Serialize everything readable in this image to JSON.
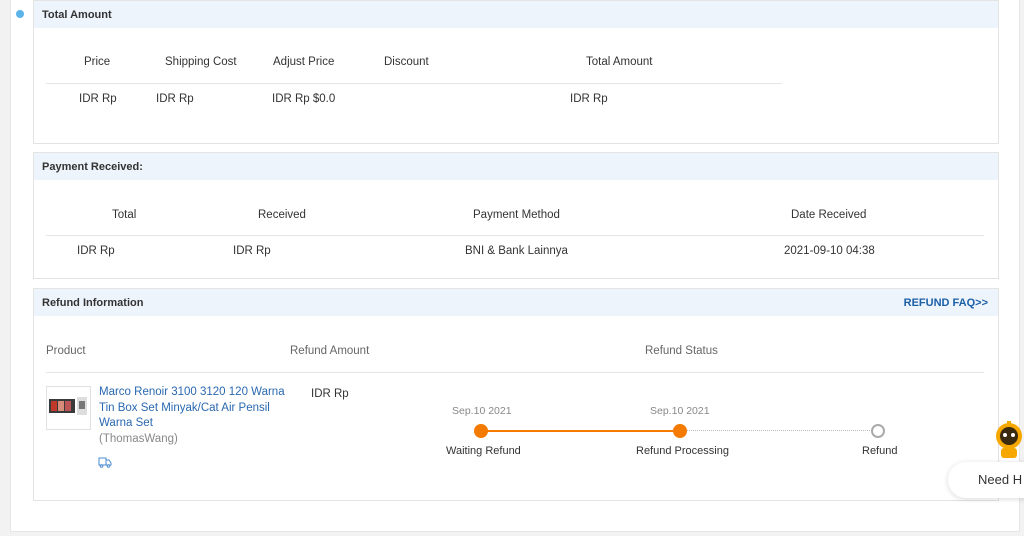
{
  "total_amount": {
    "title": "Total Amount",
    "headers": [
      "Price",
      "Shipping Cost",
      "Adjust Price",
      "Discount",
      "Total Amount"
    ],
    "row": {
      "price": "IDR Rp",
      "shipping": "IDR Rp",
      "adjust": "IDR Rp $0.0",
      "discount": "",
      "total": "IDR Rp"
    }
  },
  "payment": {
    "title": "Payment Received:",
    "headers": [
      "Total",
      "Received",
      "Payment Method",
      "Date Received"
    ],
    "row": {
      "total": "IDR Rp",
      "received": "IDR Rp",
      "method": "BNI & Bank Lainnya",
      "date": "2021-09-10 04:38"
    }
  },
  "refund": {
    "title": "Refund Information",
    "faq_link": "REFUND FAQ>>",
    "headers": [
      "Product",
      "Refund Amount",
      "Refund Status"
    ],
    "product_name": "Marco Renoir 3100 3120 120 Warna Tin Box Set Minyak/Cat Air Pensil Warna Set",
    "seller": "(ThomasWang)",
    "amount": "IDR Rp",
    "steps": [
      {
        "date": "Sep.10 2021",
        "label": "Waiting Refund",
        "state": "done"
      },
      {
        "date": "Sep.10 2021",
        "label": "Refund Processing",
        "state": "done"
      },
      {
        "date": "",
        "label": "Refund",
        "state": "todo"
      }
    ],
    "colors": {
      "accent": "#f47b00",
      "pending": "#aaaaaa"
    }
  },
  "help_widget": {
    "label": "Need H"
  }
}
